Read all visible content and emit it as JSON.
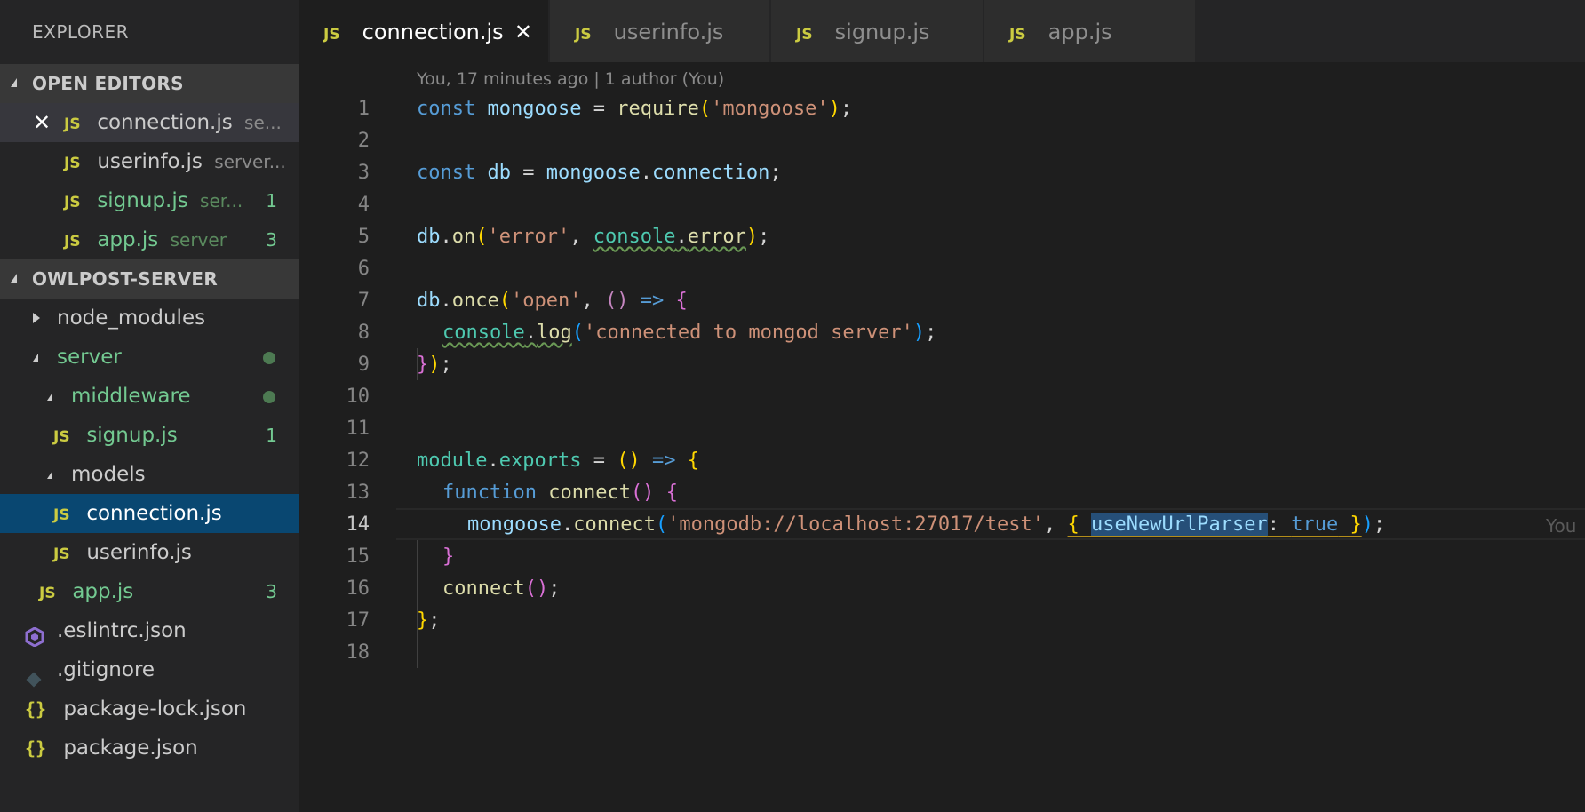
{
  "sidebar": {
    "title": "EXPLORER",
    "open_editors": {
      "label": "OPEN EDITORS",
      "items": [
        {
          "badge": "JS",
          "name": "connection.js",
          "path": "se..."
        },
        {
          "badge": "JS",
          "name": "userinfo.js",
          "path": "server..."
        },
        {
          "badge": "JS",
          "name": "signup.js",
          "path": "ser...",
          "count": "1"
        },
        {
          "badge": "JS",
          "name": "app.js",
          "path": "server",
          "count": "3"
        }
      ]
    },
    "project": {
      "label": "OWLPOST-SERVER",
      "tree": [
        {
          "name": "node_modules"
        },
        {
          "name": "server"
        },
        {
          "name": "middleware"
        },
        {
          "badge": "JS",
          "name": "signup.js",
          "count": "1"
        },
        {
          "name": "models"
        },
        {
          "badge": "JS",
          "name": "connection.js"
        },
        {
          "badge": "JS",
          "name": "userinfo.js"
        },
        {
          "badge": "JS",
          "name": "app.js",
          "count": "3"
        },
        {
          "name": ".eslintrc.json"
        },
        {
          "name": ".gitignore"
        },
        {
          "badge": "{}",
          "name": "package-lock.json"
        },
        {
          "badge": "{}",
          "name": "package.json"
        }
      ]
    }
  },
  "tabs": [
    {
      "badge": "JS",
      "label": "connection.js",
      "close": "✕"
    },
    {
      "badge": "JS",
      "label": "userinfo.js"
    },
    {
      "badge": "JS",
      "label": "signup.js"
    },
    {
      "badge": "JS",
      "label": "app.js"
    }
  ],
  "editor": {
    "blame_header": "You, 17 minutes ago | 1 author (You)",
    "inline_blame": "You",
    "line_numbers": [
      "1",
      "2",
      "3",
      "4",
      "5",
      "6",
      "7",
      "8",
      "9",
      "10",
      "11",
      "12",
      "13",
      "14",
      "15",
      "16",
      "17",
      "18"
    ],
    "code": {
      "l1": {
        "kw": "const",
        "v": "mongoose",
        "eq": " = ",
        "fn": "require",
        "po": "(",
        "s": "'mongoose'",
        "pc": ")",
        "end": ";"
      },
      "l3": {
        "kw": "const",
        "v": "db",
        "eq": " = ",
        "o": "mongoose",
        "dot": ".",
        "p": "connection",
        "end": ";"
      },
      "l5": {
        "o": "db",
        "dot": ".",
        "fn": "on",
        "po": "(",
        "s": "'error'",
        "comma": ", ",
        "c": "console",
        "dot2": ".",
        "f2": "error",
        "pc": ")",
        "end": ";"
      },
      "l7": {
        "o": "db",
        "dot": ".",
        "fn": "once",
        "po": "(",
        "s": "'open'",
        "comma": ", ",
        "args": "()",
        "arrow": " => ",
        "br": "{"
      },
      "l8": {
        "c": "console",
        "dot": ".",
        "fn": "log",
        "po": "(",
        "s": "'connected to mongod server'",
        "pc": ")",
        "end": ";"
      },
      "l9": {
        "br": "}",
        "pc": ")",
        "end": ";"
      },
      "l12": {
        "o": "module",
        "dot": ".",
        "p": "exports",
        "eq": " = ",
        "args": "()",
        "arrow": " => ",
        "br": "{"
      },
      "l13": {
        "kw": "function",
        "fn": "connect",
        "args": "()",
        "br": "{"
      },
      "l14": {
        "o": "mongoose",
        "dot": ".",
        "fn": "connect",
        "po": "(",
        "s": "'mongodb://localhost:27017/test'",
        "comma": ", ",
        "bo": "{",
        "key": "useNewUrlParser",
        "colon": ": ",
        "val": "true",
        "bc": "}",
        "pc": ")",
        "end": ";"
      },
      "l15": {
        "br": "}"
      },
      "l16": {
        "fn": "connect",
        "args": "()",
        "end": ";"
      },
      "l17": {
        "br": "}",
        "end": ";"
      }
    }
  },
  "colors": {
    "sidebar_bg": "#252526",
    "editor_bg": "#1e1e1e",
    "selection": "#094771",
    "git_modified": "#73c991",
    "js_badge": "#cbcb41"
  }
}
